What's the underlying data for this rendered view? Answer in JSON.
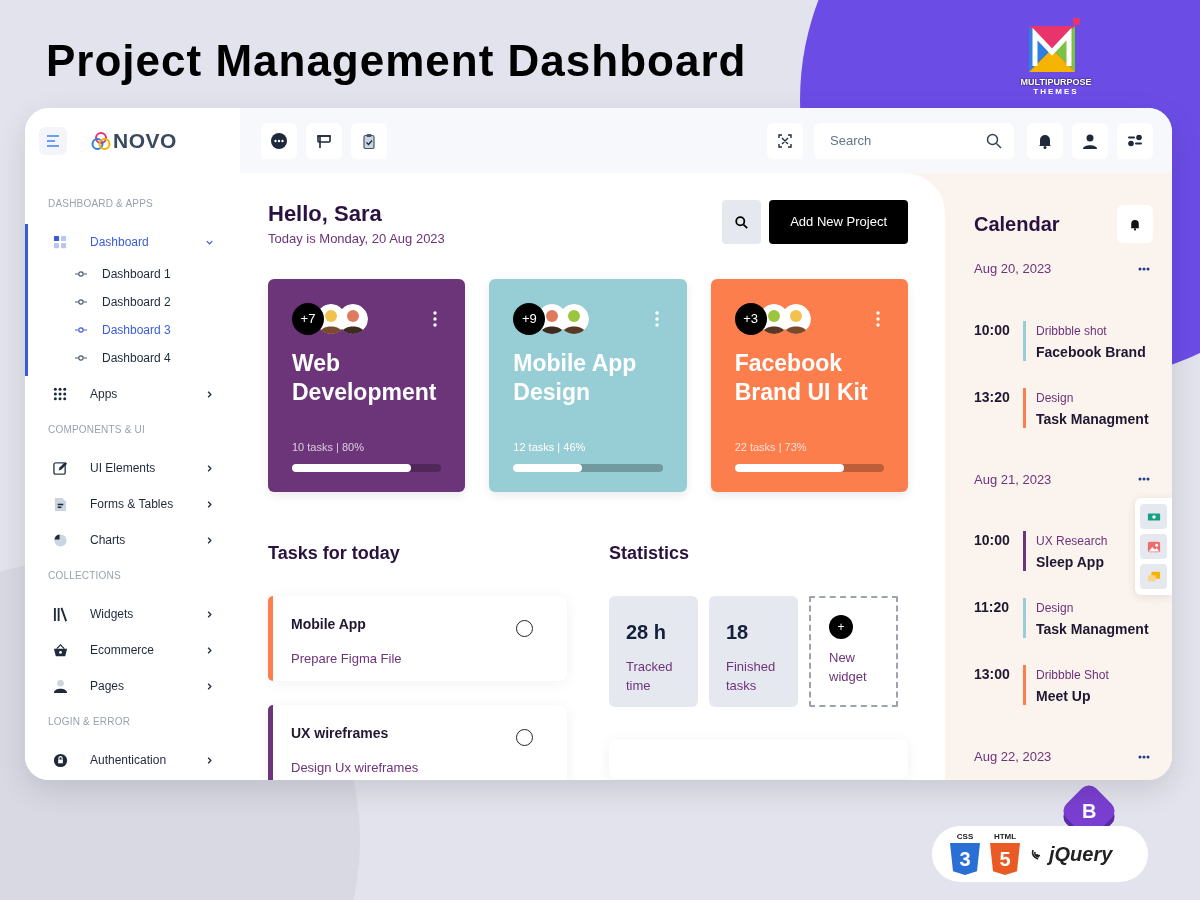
{
  "promo": {
    "title": "Project Management Dashboard",
    "brand": {
      "name": "MULTIPURPOSE",
      "tagline": "THEMES"
    },
    "badges": [
      {
        "kind": "css",
        "label": "CSS",
        "glyph": "3"
      },
      {
        "kind": "html",
        "label": "HTML",
        "glyph": "5"
      },
      {
        "kind": "jquery",
        "label": "jQuery"
      },
      {
        "kind": "bootstrap",
        "glyph": "B"
      }
    ]
  },
  "app": {
    "logo": "NOVO",
    "search": {
      "placeholder": "Search"
    },
    "sidebar": [
      {
        "title": "DASHBOARD & APPS",
        "items": [
          {
            "label": "Dashboard",
            "selected": true,
            "expanded": true,
            "children": [
              {
                "label": "Dashboard 1",
                "selected": false
              },
              {
                "label": "Dashboard 2",
                "selected": false
              },
              {
                "label": "Dashboard 3",
                "selected": true
              },
              {
                "label": "Dashboard 4",
                "selected": false
              }
            ]
          },
          {
            "label": "Apps",
            "selected": false,
            "expanded": false
          }
        ]
      },
      {
        "title": "COMPONENTS & UI",
        "items": [
          {
            "label": "UI Elements",
            "selected": false,
            "expanded": false
          },
          {
            "label": "Forms & Tables",
            "selected": false,
            "expanded": false
          },
          {
            "label": "Charts",
            "selected": false,
            "expanded": false
          }
        ]
      },
      {
        "title": "COLLECTIONS",
        "items": [
          {
            "label": "Widgets",
            "selected": false,
            "expanded": false
          },
          {
            "label": "Ecommerce",
            "selected": false,
            "expanded": false
          },
          {
            "label": "Pages",
            "selected": false,
            "expanded": false
          }
        ]
      },
      {
        "title": "LOGIN & ERROR",
        "items": [
          {
            "label": "Authentication",
            "selected": false,
            "expanded": false
          }
        ]
      }
    ],
    "greeting": "Hello, Sara",
    "date_line": "Today is Monday, 20 Aug 2023",
    "add_button": "Add New Project",
    "projects": [
      {
        "title": "Web Development",
        "members_more": "+7",
        "meta": "10 tasks | 80%",
        "level": 0.8,
        "color": "#6c3479"
      },
      {
        "title": "Mobile App Design",
        "members_more": "+9",
        "meta": "12 tasks | 46%",
        "level": 0.46,
        "color": "#97ced6"
      },
      {
        "title": "Facebook Brand UI Kit",
        "members_more": "+3",
        "meta": "22 tasks | 73%",
        "level": 0.73,
        "color": "#fd7e4d"
      }
    ],
    "tasks_title": "Tasks for today",
    "tasks": [
      {
        "title": "Mobile App",
        "subtitle": "Prepare Figma File",
        "color": "#fd7e4d",
        "checked": false
      },
      {
        "title": "UX wireframes",
        "subtitle": "Design Ux wireframes",
        "color": "#6c3479",
        "checked": false
      }
    ],
    "stats_title": "Statistics",
    "stats": [
      {
        "kind": "stat",
        "value": "28 h",
        "label": "Tracked time"
      },
      {
        "kind": "stat",
        "value": "18",
        "label": "Finished tasks"
      },
      {
        "kind": "add",
        "glyph": "+",
        "label": "New widget"
      }
    ],
    "calendar": {
      "title": "Calendar",
      "days": [
        {
          "date": "Aug 20, 2023",
          "events": [
            {
              "time": "10:00",
              "category": "Dribbble shot",
              "title": "Facebook Brand",
              "color": "#97ced6"
            },
            {
              "time": "13:20",
              "category": "Design",
              "title": "Task Managment",
              "color": "#fd7e4d"
            }
          ]
        },
        {
          "date": "Aug 21, 2023",
          "events": [
            {
              "time": "10:00",
              "category": "UX Research",
              "title": "Sleep App",
              "color": "#6c3479"
            },
            {
              "time": "11:20",
              "category": "Design",
              "title": "Task Managment",
              "color": "#97ced6"
            },
            {
              "time": "13:00",
              "category": "Dribbble Shot",
              "title": "Meet Up",
              "color": "#fd7e4d"
            }
          ]
        },
        {
          "date": "Aug 22, 2023"
        }
      ]
    }
  }
}
